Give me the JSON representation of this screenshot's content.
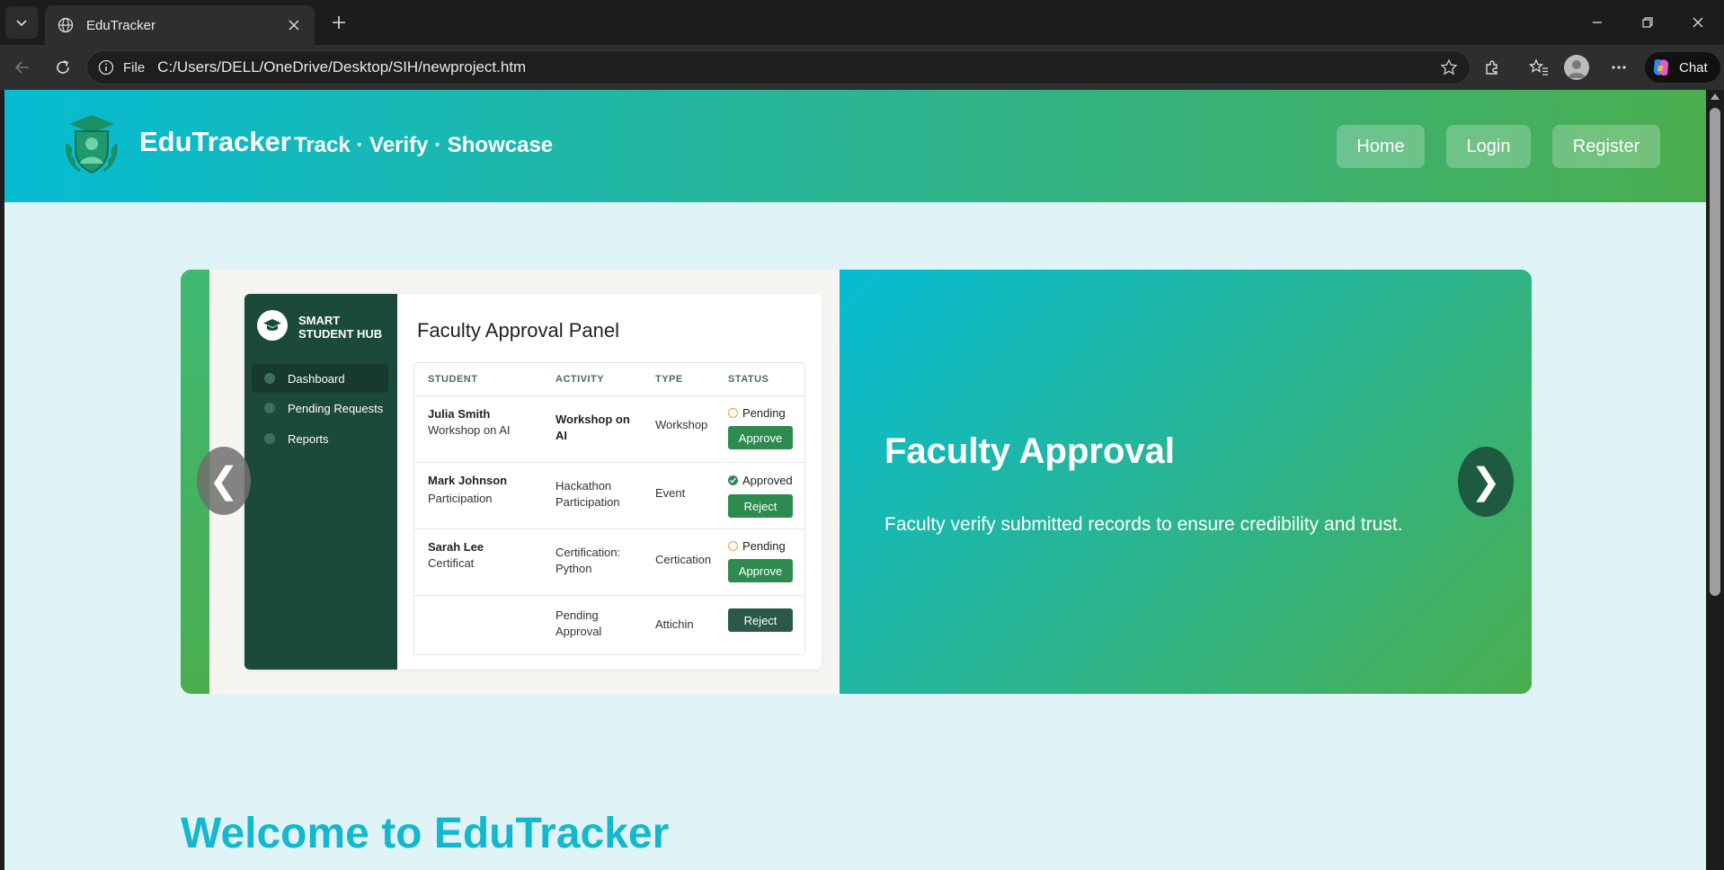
{
  "browser": {
    "tab_title": "EduTracker",
    "address_protocol": "File",
    "address_url": "C:/Users/DELL/OneDrive/Desktop/SIH/newproject.htm",
    "chat_label": "Chat"
  },
  "site": {
    "brand": "EduTracker",
    "tagline": "Track · Verify · Showcase",
    "nav": {
      "home": "Home",
      "login": "Login",
      "register": "Register"
    }
  },
  "carousel": {
    "slide_title": "Faculty Approval",
    "slide_description": "Faculty verify submitted records to ensure credibility and trust.",
    "prev_arrow": "❮",
    "next_arrow": "❯",
    "mock": {
      "brand_line1": "SMART",
      "brand_line2": "STUDENT HUB",
      "nav": [
        "Dashboard",
        "Pending Requests",
        "Reports"
      ],
      "panel_title": "Faculty Approval Panel",
      "headers": [
        "STUDENT",
        "ACTIVITY",
        "TYPE",
        "STATUS"
      ],
      "rows": [
        {
          "student_name": "Julia Smith",
          "student_sub": "Workshop on AI",
          "activity": "Workshop on AI",
          "type": "Workshop",
          "status": "Pending",
          "action": "Approve"
        },
        {
          "student_name": "Mark Johnson",
          "student_sub": "Participation",
          "activity": "Hackathon Participation",
          "type": "Event",
          "status": "Approved",
          "action": "Reject"
        },
        {
          "student_name": "Sarah Lee",
          "student_sub": "Certificat",
          "activity": "Certification: Python",
          "type": "Certication",
          "status": "Pending",
          "action": "Approve"
        },
        {
          "student_name": "",
          "student_sub": "",
          "activity": "Pending Approval",
          "type": "Attichin",
          "status": "",
          "action": "Reject"
        }
      ]
    }
  },
  "welcome_heading": "Welcome to EduTracker",
  "colors": {
    "header_gradient_start": "#06bcd3",
    "header_gradient_end": "#4aae4f",
    "page_bg": "#e0f4f7",
    "mock_sidebar": "#1c4a38",
    "approve_button": "#2e8b50",
    "reject_button_dark": "#2a5a47",
    "welcome_text": "#13b8cf"
  },
  "icons": {
    "tab_favicon": "globe-icon",
    "logo": "graduation-shield-logo",
    "status_pending": "clock-icon",
    "status_approved": "check-circle-icon"
  }
}
